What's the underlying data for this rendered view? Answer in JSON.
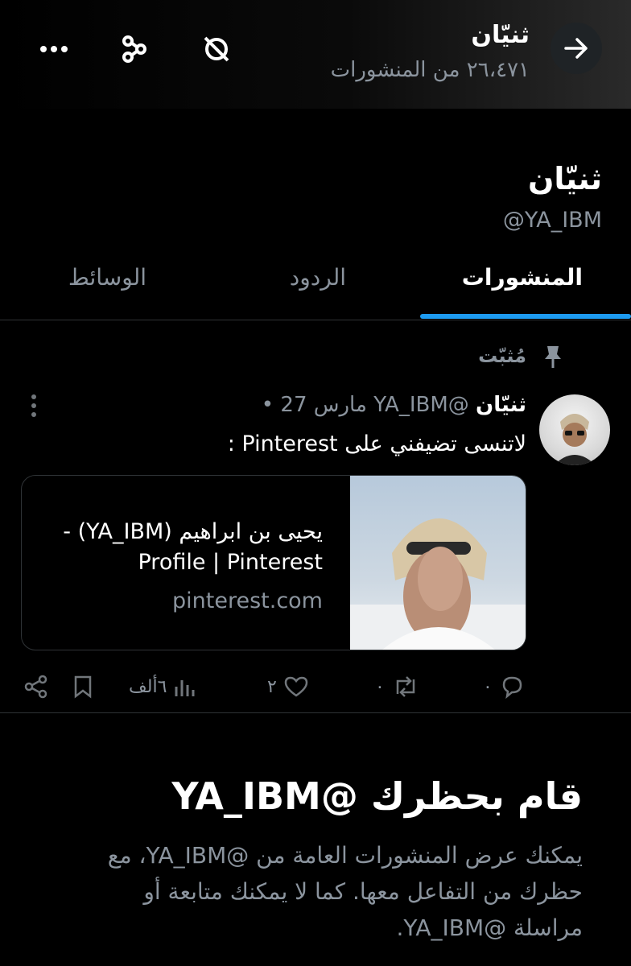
{
  "header": {
    "name": "ثنيّان",
    "post_count": "٢٦،٤٧١ من المنشورات"
  },
  "profile": {
    "name": "ثنيّان",
    "handle": "@YA_IBM"
  },
  "tabs": [
    {
      "label": "المنشورات",
      "active": true
    },
    {
      "label": "الردود",
      "active": false
    },
    {
      "label": "الوسائط",
      "active": false
    }
  ],
  "post": {
    "pinned_label": "مُثبّت",
    "author": "ثنيّان",
    "handle": "@YA_IBM",
    "date": "مارس 27",
    "text": "لاتنسى تضيفني على Pinterest :",
    "card": {
      "title_line1": "يحيى بن ابراهيم (YA_IBM) -",
      "title_line2": "Profile | Pinterest",
      "domain": "pinterest.com"
    },
    "actions": {
      "replies": "٠",
      "reposts": "٠",
      "likes": "٢",
      "views": "٦ألف"
    }
  },
  "blocked": {
    "title": "قام بحظرك @YA_IBM",
    "description": "يمكنك عرض المنشورات العامة من @YA_IBM، مع حظرك من التفاعل معها. كما لا يمكنك متابعة أو مراسلة @YA_IBM."
  },
  "colors": {
    "accent": "#1d9bf0",
    "background": "#000000",
    "muted_text": "#8b949e"
  }
}
